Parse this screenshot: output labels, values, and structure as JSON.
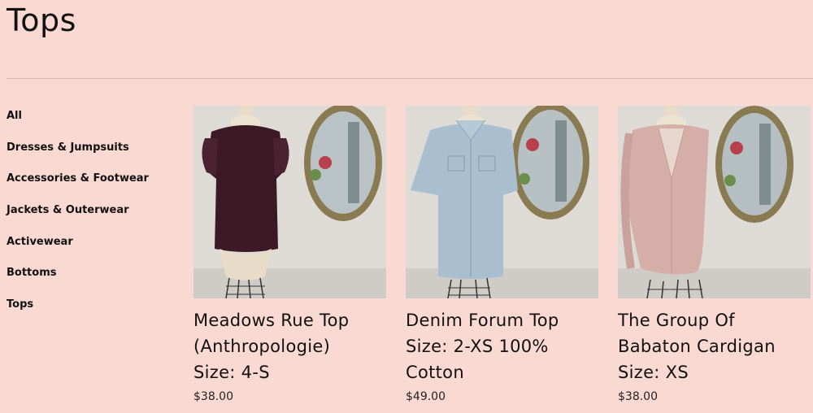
{
  "page": {
    "title": "Tops"
  },
  "sidebar": {
    "items": [
      {
        "label": "All"
      },
      {
        "label": "Dresses & Jumpsuits"
      },
      {
        "label": "Accessories & Footwear"
      },
      {
        "label": "Jackets & Outerwear"
      },
      {
        "label": "Activewear"
      },
      {
        "label": "Bottoms"
      },
      {
        "label": "Tops",
        "active": true
      }
    ]
  },
  "products": [
    {
      "title": "Meadows Rue Top\n(Anthropologie)\nSize: 4-S",
      "price": "$38.00",
      "garment_color": "#3b1a26"
    },
    {
      "title": "Denim Forum Top\nSize: 2-XS 100%\nCotton",
      "price": "$49.00",
      "garment_color": "#a9bfcf"
    },
    {
      "title": "The Group Of\nBabaton Cardigan\nSize: XS",
      "price": "$38.00",
      "garment_color": "#d6aea8"
    }
  ],
  "colors": {
    "background": "#fbd9d3",
    "text": "#111111",
    "divider": "#d8b8b2",
    "wall": "#dedbd7",
    "mirror_frame": "#8a7a52"
  }
}
